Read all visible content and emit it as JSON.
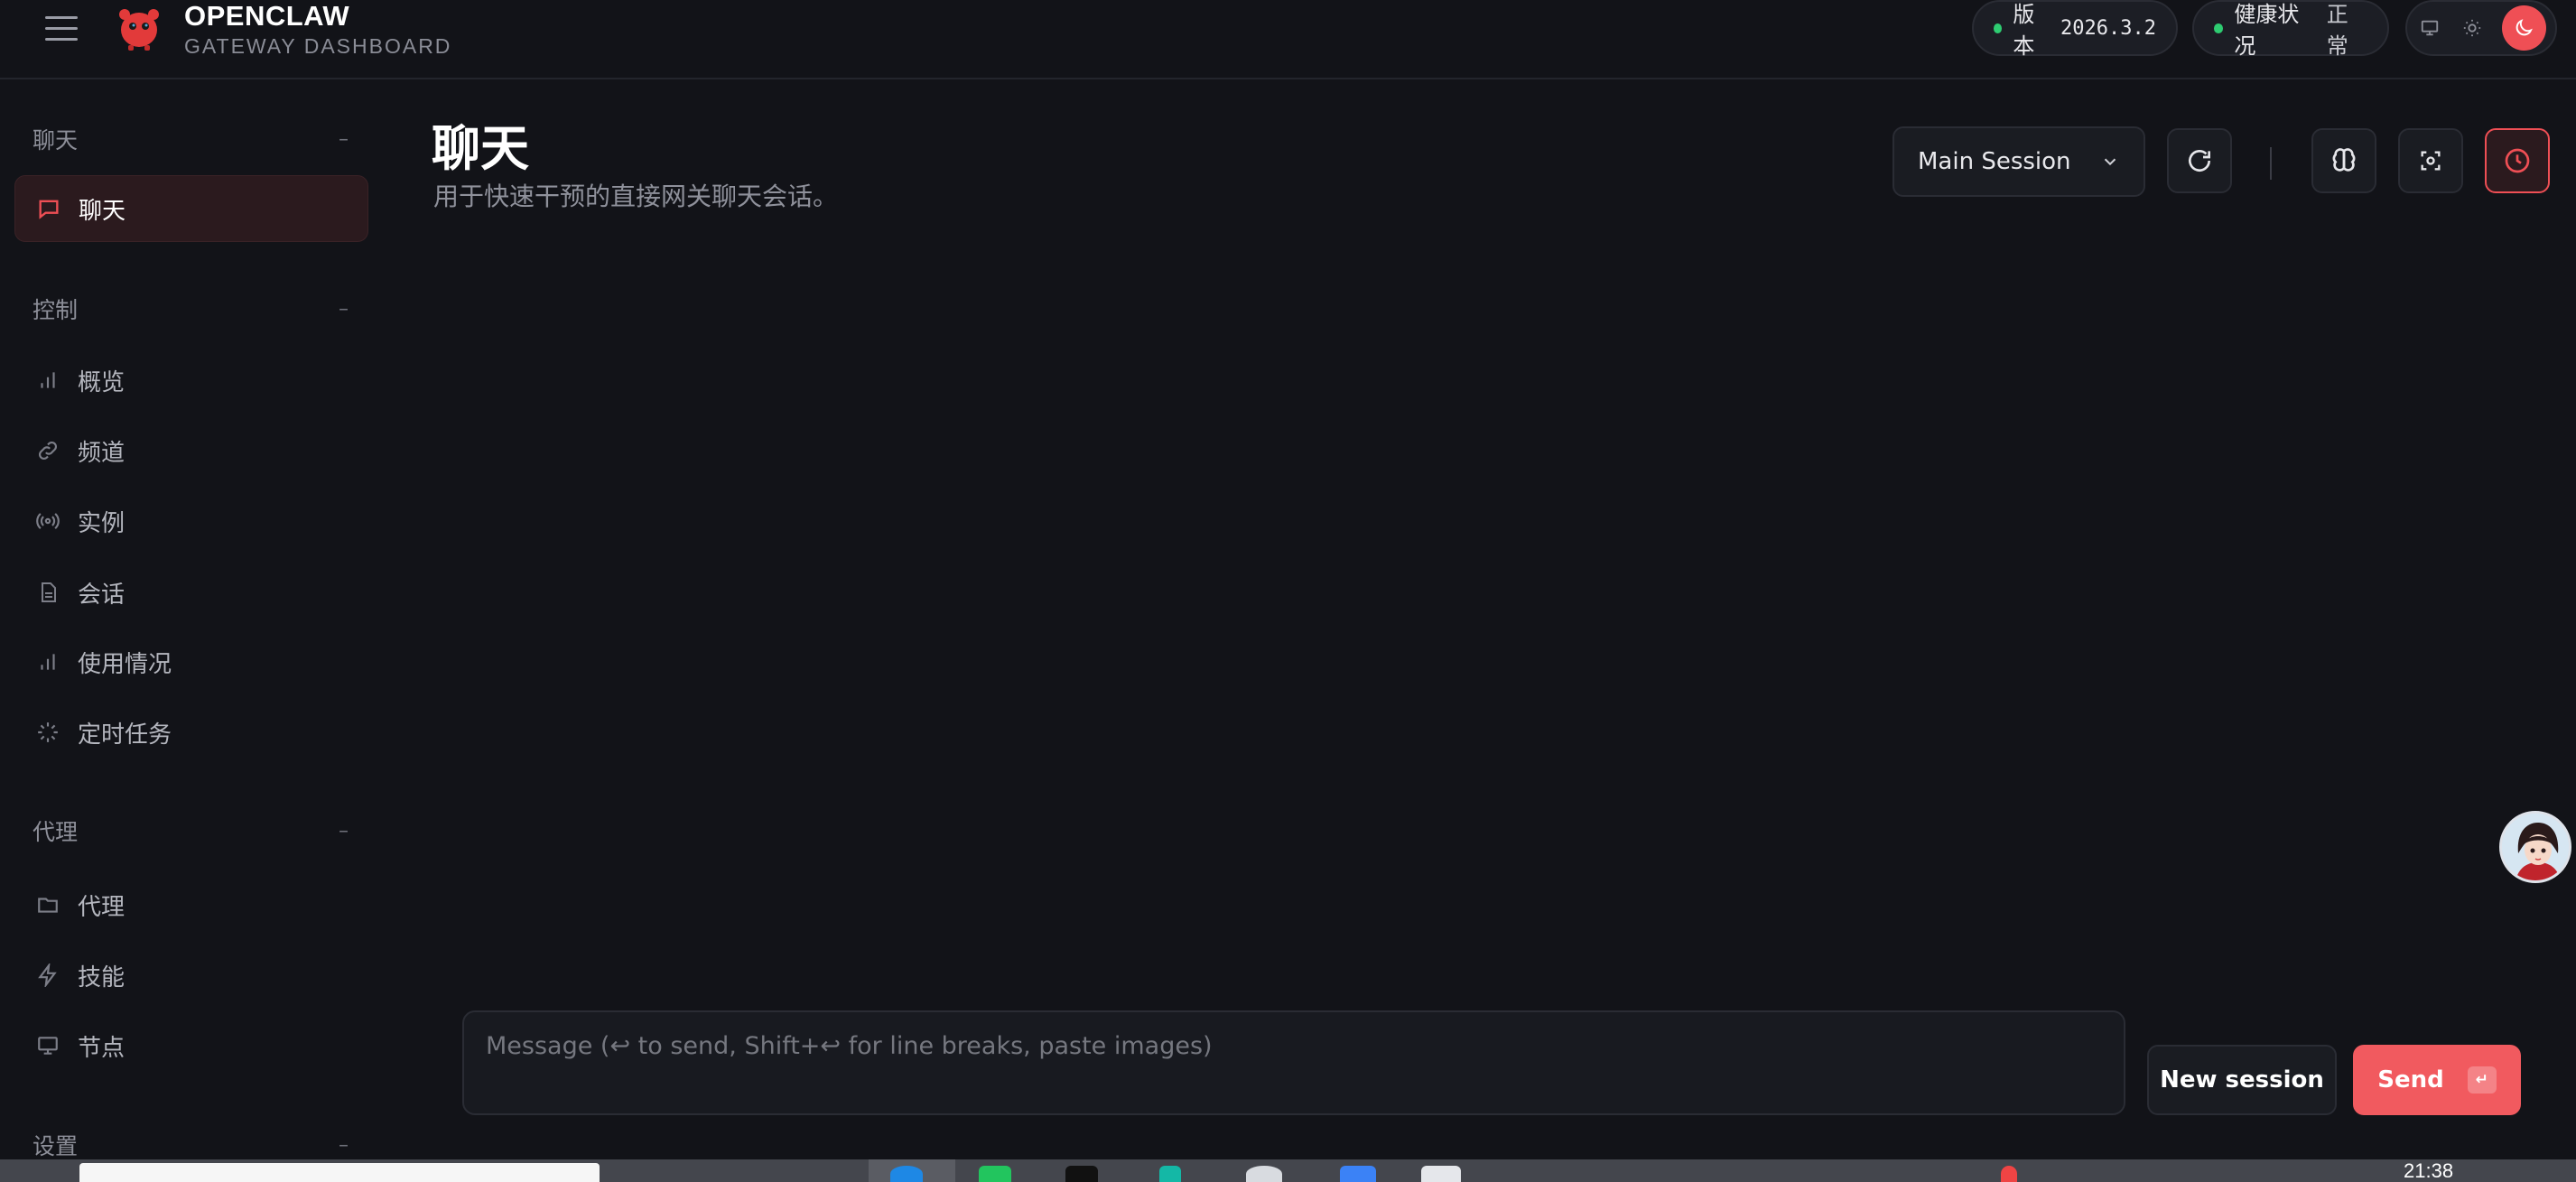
{
  "header": {
    "brand_title": "OPENCLAW",
    "brand_subtitle": "GATEWAY DASHBOARD",
    "version_label": "版本",
    "version_value": "2026.3.2",
    "health_label": "健康状况",
    "health_value": "正常",
    "status_color": "#2ecc71",
    "accent_color": "#ef4f55"
  },
  "sidebar": {
    "sections": [
      {
        "title": "聊天",
        "collapse": "–"
      },
      {
        "title": "控制",
        "collapse": "–"
      },
      {
        "title": "代理",
        "collapse": "–"
      },
      {
        "title": "设置",
        "collapse": "–"
      }
    ],
    "items": [
      {
        "label": "聊天",
        "icon": "message-icon",
        "active": true
      },
      {
        "label": "概览",
        "icon": "bar-chart-icon"
      },
      {
        "label": "频道",
        "icon": "link-icon"
      },
      {
        "label": "实例",
        "icon": "radio-icon"
      },
      {
        "label": "会话",
        "icon": "file-icon"
      },
      {
        "label": "使用情况",
        "icon": "bar-chart-icon"
      },
      {
        "label": "定时任务",
        "icon": "loader-icon"
      },
      {
        "label": "代理",
        "icon": "folder-icon"
      },
      {
        "label": "技能",
        "icon": "zap-icon"
      },
      {
        "label": "节点",
        "icon": "monitor-icon"
      }
    ]
  },
  "main": {
    "title": "聊天",
    "subtitle": "用于快速干预的直接网关聊天会话。",
    "session_select": "Main Session",
    "composer_placeholder": "Message (↩ to send, Shift+↩ for line breaks, paste images)",
    "new_session_label": "New session",
    "send_label": "Send",
    "send_shortcut": "↵"
  },
  "taskbar": {
    "clock": "21:38"
  }
}
